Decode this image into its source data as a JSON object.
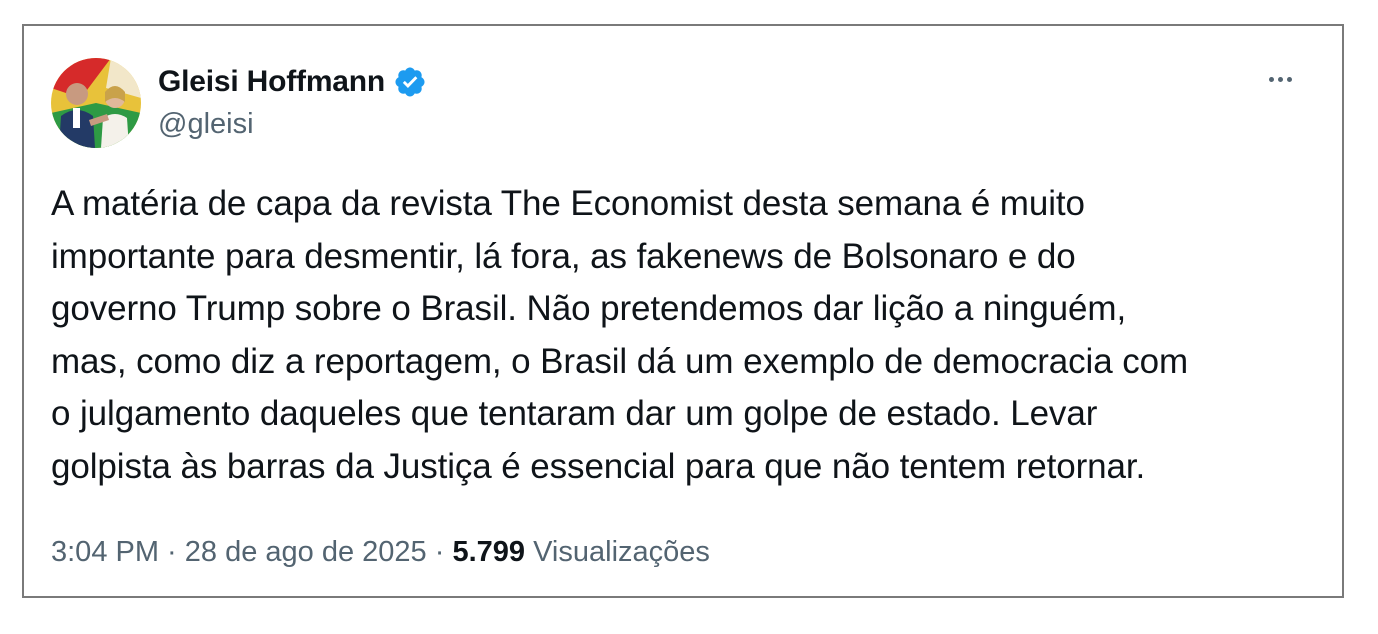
{
  "author": {
    "name": "Gleisi Hoffmann",
    "handle": "@gleisi",
    "verified_icon": "verified-badge-icon",
    "verified_color": "#1d9bf0"
  },
  "menu": {
    "more_icon": "more-horizontal-icon"
  },
  "tweet": {
    "text": "A matéria de capa da revista The Economist desta semana é muito\nimportante para desmentir, lá fora, as fakenews de Bolsonaro e do\ngoverno Trump sobre o Brasil. Não pretendemos dar lição a ninguém,\nmas, como diz a reportagem, o Brasil dá um exemplo de democracia com\no julgamento daqueles que tentaram dar um golpe de estado. Levar\ngolpista às barras da Justiça é essencial para que não tentem retornar."
  },
  "meta": {
    "time": "3:04 PM",
    "separator": " · ",
    "date": "28 de ago de 2025",
    "views_count": "5.799",
    "views_label": "Visualizações"
  },
  "colors": {
    "text_primary": "#0f1419",
    "text_secondary": "#536471",
    "border": "#7a7a7a"
  }
}
